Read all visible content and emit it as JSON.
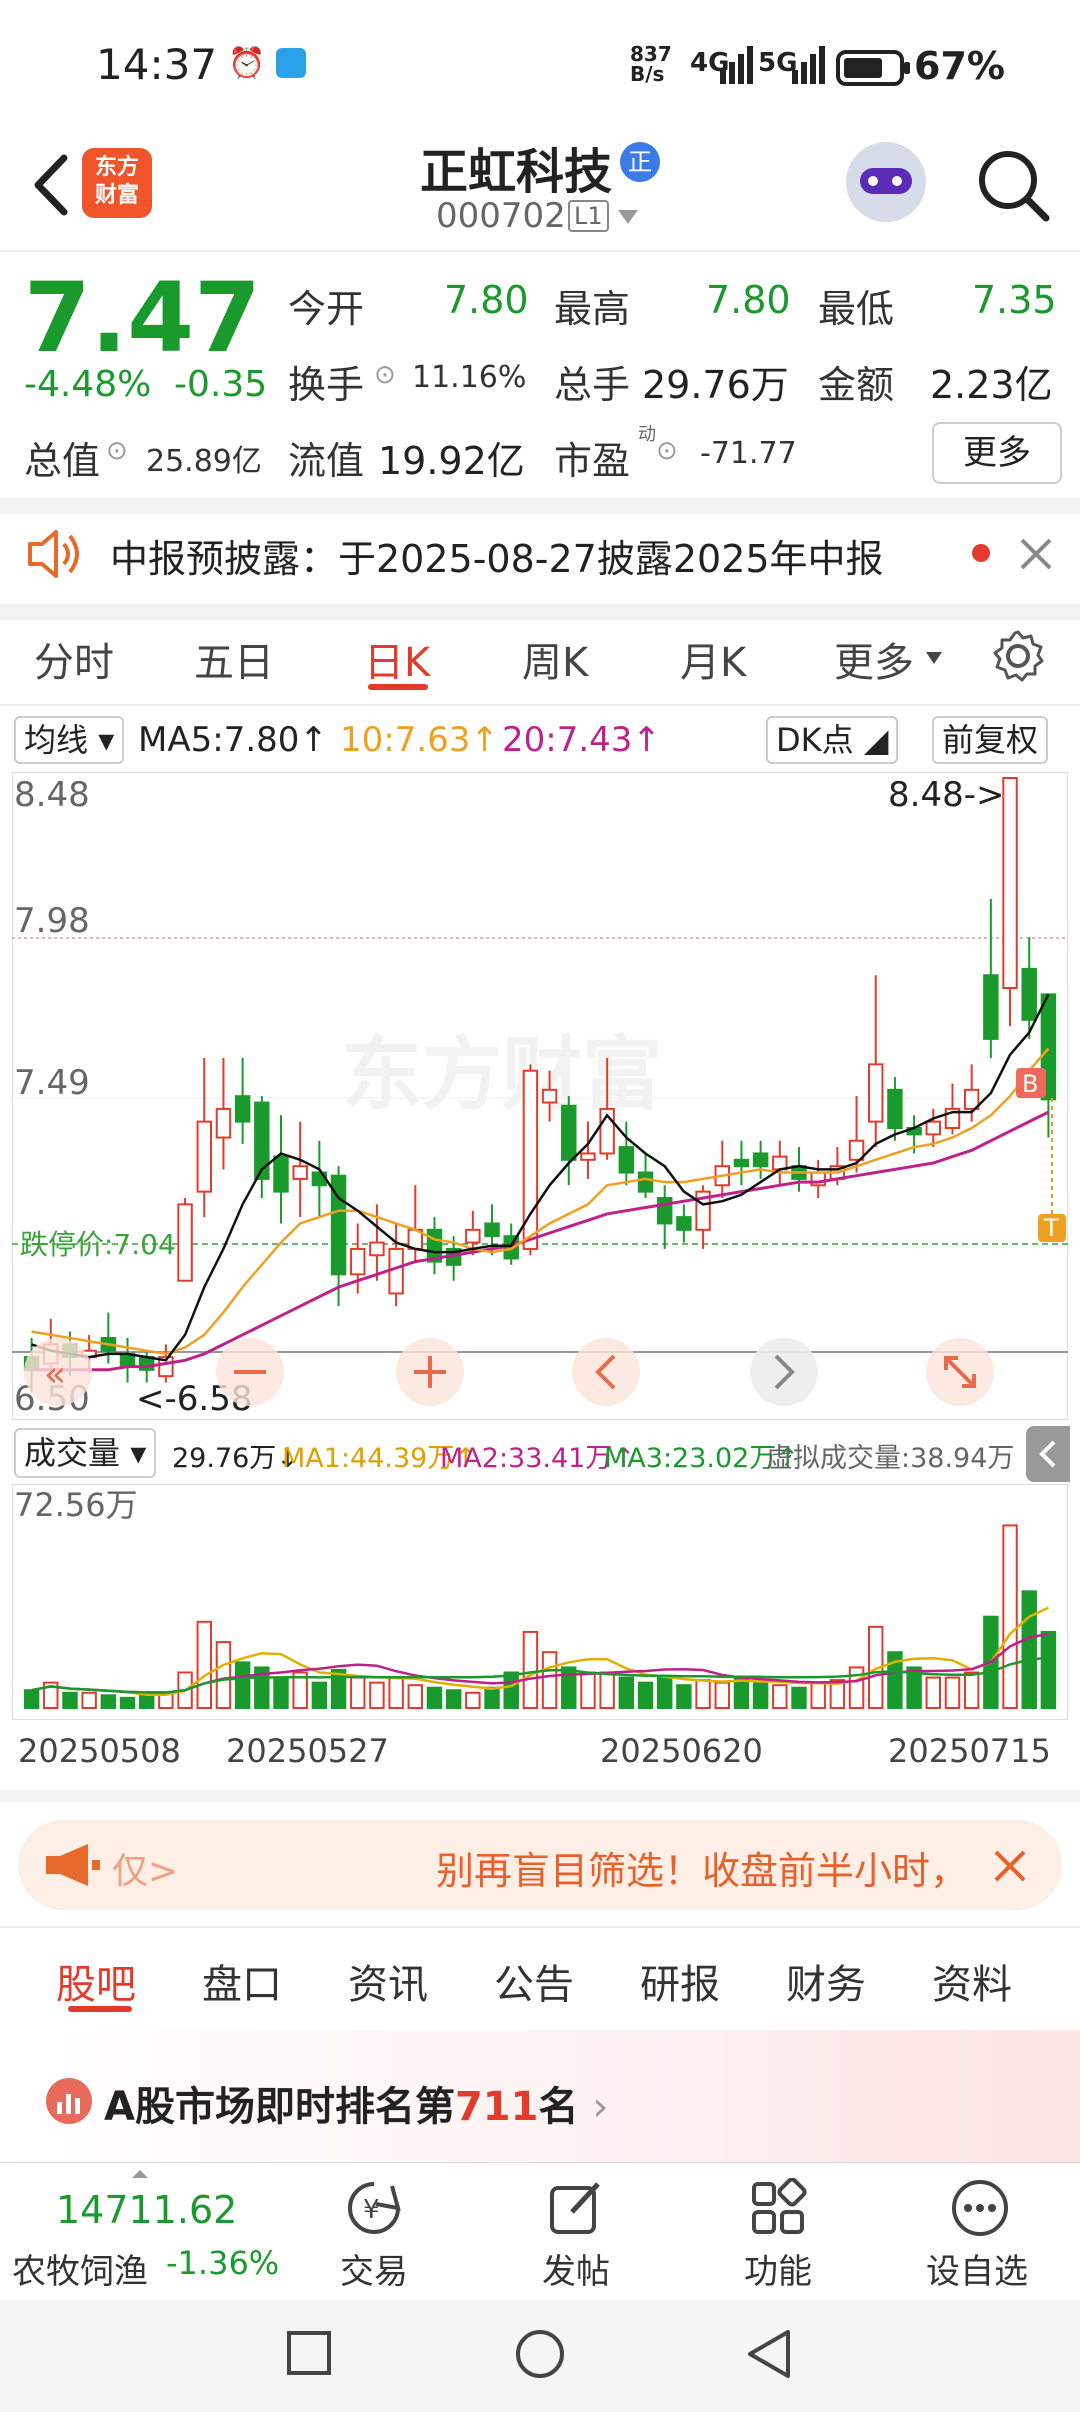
{
  "status_bar": {
    "time": "14:37",
    "net_speed": "837 B/s",
    "net1": "4G",
    "net2": "5G",
    "battery": "67%"
  },
  "header": {
    "name": "正虹科技",
    "badge": "正",
    "code": "000702",
    "level": "L1",
    "logo_line1": "东方",
    "logo_line2": "财富"
  },
  "quote": {
    "price": "7.47",
    "change_pct": "-4.48%",
    "change": "-0.35",
    "open_label": "今开",
    "open": "7.80",
    "high_label": "最高",
    "high": "7.80",
    "low_label": "最低",
    "low": "7.35",
    "turnover_label": "换手",
    "turnover": "11.16%",
    "volume_label": "总手",
    "volume": "29.76万",
    "amount_label": "金额",
    "amount": "2.23亿",
    "mktcap_label": "总值",
    "mktcap": "25.89亿",
    "float_label": "流值",
    "float": "19.92亿",
    "pe_label": "市盈",
    "pe_sup": "动",
    "pe": "-71.77",
    "more": "更多"
  },
  "notice": {
    "text": "中报预披露：于2025-08-27披露2025年中报"
  },
  "chart_tabs": [
    "分时",
    "五日",
    "日K",
    "周K",
    "月K",
    "更多"
  ],
  "ma_bar": {
    "selector": "均线",
    "ma5": "MA5:7.80↑",
    "ma10": "10:7.63↑",
    "ma20": "20:7.43↑",
    "dk": "DK点",
    "adjust": "前复权"
  },
  "kline": {
    "y_labels": [
      "8.48",
      "7.98",
      "7.49",
      "6.50"
    ],
    "limit_down": "跌停价:7.04",
    "high_marker": "8.48->",
    "low_marker": "<-6.58",
    "b_marker": "B",
    "t_marker": "T",
    "watermark": "东方财富"
  },
  "volume_bar": {
    "selector": "成交量",
    "vol": "29.76万↓",
    "ma1": "MA1:44.39万↑",
    "ma2": "MA2:33.41万↑",
    "ma3": "MA3:23.02万↑",
    "virtual": "虚拟成交量:38.94万",
    "max_label": "72.56万"
  },
  "dates": [
    "20250508",
    "20250527",
    "20250620",
    "20250715"
  ],
  "colors": {
    "up": "#e23b2b",
    "down": "#1a9a2c",
    "ma5": "#111111",
    "ma10": "#f0a020",
    "ma20": "#c0208a"
  },
  "banner": {
    "left": "仅>",
    "text": "别再盲目筛选！收盘前半小时，"
  },
  "bottom_tabs": [
    "股吧",
    "盘口",
    "资讯",
    "公告",
    "研报",
    "财务",
    "资料"
  ],
  "rank": {
    "prefix": "A股市场即时排名第",
    "num": "711",
    "suffix": "名"
  },
  "bottom_nav": {
    "index_value": "14711.62",
    "index_name": "农牧饲渔",
    "index_pct": "-1.36%",
    "items": [
      "交易",
      "发帖",
      "功能",
      "设自选"
    ]
  },
  "chart_data": {
    "type": "candlestick",
    "candles": [
      {
        "o": 6.66,
        "c": 6.62,
        "h": 6.72,
        "l": 6.55
      },
      {
        "o": 6.64,
        "c": 6.7,
        "h": 6.78,
        "l": 6.58
      },
      {
        "o": 6.7,
        "c": 6.66,
        "h": 6.74,
        "l": 6.6
      },
      {
        "o": 6.66,
        "c": 6.68,
        "h": 6.73,
        "l": 6.61
      },
      {
        "o": 6.72,
        "c": 6.68,
        "h": 6.8,
        "l": 6.64
      },
      {
        "o": 6.67,
        "c": 6.63,
        "h": 6.72,
        "l": 6.58
      },
      {
        "o": 6.66,
        "c": 6.62,
        "h": 6.68,
        "l": 6.58
      },
      {
        "o": 6.6,
        "c": 6.66,
        "h": 6.7,
        "l": 6.58
      },
      {
        "o": 6.9,
        "c": 7.14,
        "h": 7.16,
        "l": 6.9
      },
      {
        "o": 7.18,
        "c": 7.4,
        "h": 7.6,
        "l": 7.1
      },
      {
        "o": 7.35,
        "c": 7.44,
        "h": 7.6,
        "l": 7.25
      },
      {
        "o": 7.48,
        "c": 7.4,
        "h": 7.6,
        "l": 7.33
      },
      {
        "o": 7.46,
        "c": 7.22,
        "h": 7.48,
        "l": 7.16
      },
      {
        "o": 7.29,
        "c": 7.18,
        "h": 7.42,
        "l": 7.08
      },
      {
        "o": 7.22,
        "c": 7.26,
        "h": 7.4,
        "l": 7.1
      },
      {
        "o": 7.24,
        "c": 7.2,
        "h": 7.34,
        "l": 7.1
      },
      {
        "o": 7.23,
        "c": 6.92,
        "h": 7.26,
        "l": 6.82
      },
      {
        "o": 6.92,
        "c": 7.0,
        "h": 7.08,
        "l": 6.86
      },
      {
        "o": 6.98,
        "c": 7.02,
        "h": 7.14,
        "l": 6.9
      },
      {
        "o": 6.86,
        "c": 7.0,
        "h": 7.08,
        "l": 6.82
      },
      {
        "o": 7.0,
        "c": 7.06,
        "h": 7.2,
        "l": 6.96
      },
      {
        "o": 7.06,
        "c": 6.96,
        "h": 7.1,
        "l": 6.92
      },
      {
        "o": 7.0,
        "c": 6.95,
        "h": 7.04,
        "l": 6.9
      },
      {
        "o": 7.02,
        "c": 7.06,
        "h": 7.12,
        "l": 6.98
      },
      {
        "o": 7.08,
        "c": 7.04,
        "h": 7.14,
        "l": 6.98
      },
      {
        "o": 7.04,
        "c": 6.97,
        "h": 7.08,
        "l": 6.95
      },
      {
        "o": 7.0,
        "c": 7.56,
        "h": 7.58,
        "l": 6.98
      },
      {
        "o": 7.46,
        "c": 7.5,
        "h": 7.56,
        "l": 7.4
      },
      {
        "o": 7.45,
        "c": 7.28,
        "h": 7.48,
        "l": 7.2
      },
      {
        "o": 7.28,
        "c": 7.3,
        "h": 7.4,
        "l": 7.22
      },
      {
        "o": 7.3,
        "c": 7.44,
        "h": 7.6,
        "l": 7.28
      },
      {
        "o": 7.32,
        "c": 7.24,
        "h": 7.4,
        "l": 7.2
      },
      {
        "o": 7.24,
        "c": 7.18,
        "h": 7.3,
        "l": 7.16
      },
      {
        "o": 7.16,
        "c": 7.08,
        "h": 7.2,
        "l": 7.0
      },
      {
        "o": 7.1,
        "c": 7.06,
        "h": 7.14,
        "l": 7.02
      },
      {
        "o": 7.06,
        "c": 7.18,
        "h": 7.2,
        "l": 7.0
      },
      {
        "o": 7.2,
        "c": 7.26,
        "h": 7.34,
        "l": 7.16
      },
      {
        "o": 7.28,
        "c": 7.26,
        "h": 7.34,
        "l": 7.2
      },
      {
        "o": 7.3,
        "c": 7.26,
        "h": 7.34,
        "l": 7.22
      },
      {
        "o": 7.25,
        "c": 7.29,
        "h": 7.34,
        "l": 7.2
      },
      {
        "o": 7.26,
        "c": 7.22,
        "h": 7.32,
        "l": 7.18
      },
      {
        "o": 7.2,
        "c": 7.24,
        "h": 7.28,
        "l": 7.16
      },
      {
        "o": 7.22,
        "c": 7.26,
        "h": 7.32,
        "l": 7.2
      },
      {
        "o": 7.28,
        "c": 7.34,
        "h": 7.48,
        "l": 7.24
      },
      {
        "o": 7.4,
        "c": 7.58,
        "h": 7.86,
        "l": 7.32
      },
      {
        "o": 7.5,
        "c": 7.38,
        "h": 7.54,
        "l": 7.34
      },
      {
        "o": 7.38,
        "c": 7.36,
        "h": 7.42,
        "l": 7.3
      },
      {
        "o": 7.36,
        "c": 7.4,
        "h": 7.44,
        "l": 7.32
      },
      {
        "o": 7.38,
        "c": 7.44,
        "h": 7.52,
        "l": 7.36
      },
      {
        "o": 7.44,
        "c": 7.5,
        "h": 7.58,
        "l": 7.4
      },
      {
        "o": 7.86,
        "c": 7.66,
        "h": 8.1,
        "l": 7.6
      },
      {
        "o": 7.82,
        "c": 8.48,
        "h": 8.48,
        "l": 7.7
      },
      {
        "o": 7.88,
        "c": 7.72,
        "h": 7.98,
        "l": 7.66
      },
      {
        "o": 7.8,
        "c": 7.47,
        "h": 7.8,
        "l": 7.35
      }
    ],
    "ma5": [
      6.7,
      6.68,
      6.67,
      6.66,
      6.67,
      6.67,
      6.66,
      6.65,
      6.73,
      6.88,
      7.0,
      7.14,
      7.25,
      7.3,
      7.28,
      7.25,
      7.16,
      7.12,
      7.07,
      7.02,
      7.0,
      6.99,
      6.99,
      7.0,
      7.01,
      7.01,
      7.11,
      7.2,
      7.27,
      7.33,
      7.42,
      7.35,
      7.3,
      7.26,
      7.18,
      7.14,
      7.15,
      7.17,
      7.21,
      7.25,
      7.26,
      7.25,
      7.25,
      7.27,
      7.33,
      7.36,
      7.38,
      7.41,
      7.43,
      7.43,
      7.49,
      7.61,
      7.68,
      7.8
    ],
    "ma10": [
      6.74,
      6.73,
      6.72,
      6.71,
      6.7,
      6.69,
      6.68,
      6.67,
      6.69,
      6.73,
      6.8,
      6.88,
      6.95,
      7.02,
      7.08,
      7.1,
      7.12,
      7.12,
      7.1,
      7.08,
      7.06,
      7.03,
      7.02,
      7.0,
      6.99,
      7.0,
      7.04,
      7.08,
      7.11,
      7.14,
      7.2,
      7.21,
      7.22,
      7.21,
      7.21,
      7.22,
      7.23,
      7.24,
      7.25,
      7.24,
      7.24,
      7.24,
      7.24,
      7.26,
      7.28,
      7.3,
      7.32,
      7.33,
      7.35,
      7.38,
      7.42,
      7.48,
      7.56,
      7.63
    ],
    "ma20": [
      6.62,
      6.62,
      6.62,
      6.62,
      6.62,
      6.63,
      6.63,
      6.64,
      6.65,
      6.67,
      6.7,
      6.73,
      6.76,
      6.79,
      6.82,
      6.85,
      6.88,
      6.9,
      6.92,
      6.94,
      6.96,
      6.97,
      6.98,
      6.99,
      7.0,
      7.01,
      7.03,
      7.05,
      7.07,
      7.09,
      7.11,
      7.12,
      7.13,
      7.14,
      7.15,
      7.16,
      7.17,
      7.18,
      7.19,
      7.2,
      7.21,
      7.21,
      7.22,
      7.23,
      7.24,
      7.25,
      7.26,
      7.27,
      7.29,
      7.31,
      7.34,
      7.37,
      7.4,
      7.43
    ],
    "volumes": [
      7,
      10,
      6,
      6,
      5,
      4,
      5,
      6,
      14,
      34,
      26,
      18,
      16,
      12,
      14,
      10,
      15,
      12,
      10,
      12,
      9,
      8,
      7,
      6,
      8,
      14,
      30,
      22,
      16,
      14,
      14,
      12,
      10,
      12,
      9,
      11,
      10,
      12,
      10,
      9,
      8,
      10,
      11,
      16,
      32,
      22,
      16,
      12,
      12,
      14,
      36,
      72,
      46,
      30
    ],
    "ylim": [
      6.5,
      8.48
    ],
    "vol_max": 72.56
  }
}
